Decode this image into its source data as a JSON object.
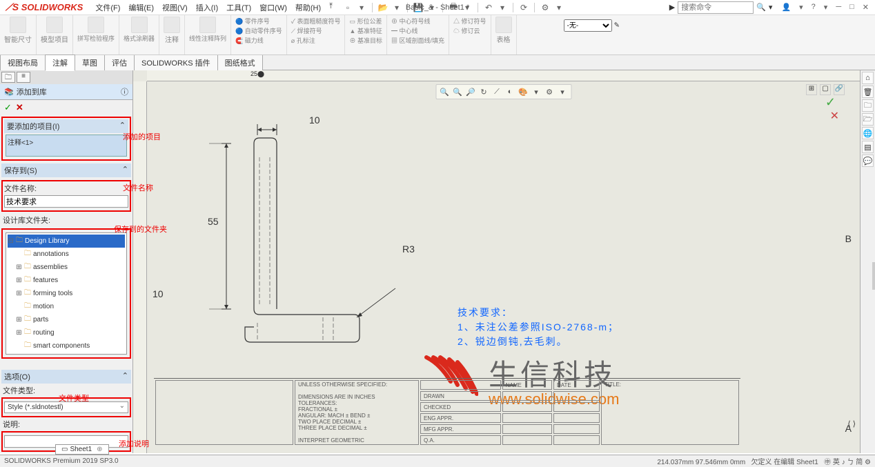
{
  "app": {
    "name": "SOLIDWORKS",
    "doc_title": "Basic_&  -  Sheet1 *",
    "search_placeholder": "搜索命令"
  },
  "menus": [
    "文件(F)",
    "编辑(E)",
    "视图(V)",
    "插入(I)",
    "工具(T)",
    "窗口(W)",
    "帮助(H)"
  ],
  "ribbon": {
    "groups": [
      {
        "label": "智能尺寸"
      },
      {
        "label": "模型项目"
      },
      {
        "label": "拼写检验程序"
      },
      {
        "label": "格式涂刷器"
      },
      {
        "label": "注释"
      },
      {
        "label": "线性注释阵列"
      },
      {
        "label": "零件序号"
      },
      {
        "label": "自动零件序号"
      },
      {
        "label": "磁力线"
      },
      {
        "label": "表面粗糙度符号"
      },
      {
        "label": "焊接符号"
      },
      {
        "label": "孔标注"
      },
      {
        "label": "形位公差"
      },
      {
        "label": "基准特征"
      },
      {
        "label": "基准目标"
      },
      {
        "label": "中心符号线"
      },
      {
        "label": "中心线"
      },
      {
        "label": "区域剖面线/填充"
      },
      {
        "label": "修订符号"
      },
      {
        "label": "修订云"
      },
      {
        "label": "表格"
      }
    ],
    "filter": "-无-"
  },
  "tabs": [
    "视图布局",
    "注解",
    "草图",
    "评估",
    "SOLIDWORKS 插件",
    "图纸格式"
  ],
  "active_tab": "注解",
  "panel": {
    "title": "添加到库",
    "sec_items": {
      "header": "要添加的项目(I)",
      "value": "注释<1>",
      "annot": "添加的项目"
    },
    "sec_save": {
      "header": "保存到(S)",
      "name_label": "文件名称:",
      "name_value": "技术要求",
      "annot": "文件名称",
      "folder_label": "设计库文件夹:",
      "folder_annot": "保存到的文件夹"
    },
    "tree": {
      "root": "Design Library",
      "children": [
        "annotations",
        "assemblies",
        "features",
        "forming tools",
        "motion",
        "parts",
        "routing",
        "smart components"
      ]
    },
    "sec_opts": {
      "header": "选项(O)",
      "type_label": "文件类型:",
      "type_annot": "文件类型",
      "type_value": "Style (*.sldnotestl)",
      "desc_label": "说明:",
      "desc_annot": "添加说明"
    }
  },
  "drawing": {
    "dims": {
      "top": "10",
      "left": "55",
      "bottom": "10",
      "radius": "R3"
    },
    "tech_note": {
      "title": "技术要求：",
      "l1": "1、未注公差参照ISO-2768-m；",
      "l2": "2、锐边倒钝,去毛刺。"
    },
    "zones": {
      "b": "B",
      "a": "A"
    },
    "title_block": {
      "h1": "UNLESS OTHERWISE SPECIFIED:",
      "h2": "DIMENSIONS ARE IN INCHES",
      "h3": "TOLERANCES:",
      "h4": "FRACTIONAL ±",
      "h5": "ANGULAR: MACH ±   BEND ±",
      "h6": "TWO PLACE DECIMAL   ±",
      "h7": "THREE PLACE DECIMAL  ±",
      "h8": "INTERPRET GEOMETRIC",
      "c_drawn": "DRAWN",
      "c_check": "CHECKED",
      "c_eng": "ENG APPR.",
      "c_mfg": "MFG APPR.",
      "c_qa": "Q.A.",
      "c_name": "NAME",
      "c_date": "DATE",
      "c_title": "TITLE:"
    },
    "watermark": {
      "text": "生信科技",
      "url": "www.solidwise.com"
    }
  },
  "sheet_tab": "Sheet1",
  "status": {
    "version": "SOLIDWORKS Premium 2019 SP3.0",
    "coord": "214.037mm    97.546mm    0mm",
    "mode": "欠定义  在编辑 Sheet1",
    "ime": "㊥ 英 ♪ ㄅ 简 ⚙"
  }
}
